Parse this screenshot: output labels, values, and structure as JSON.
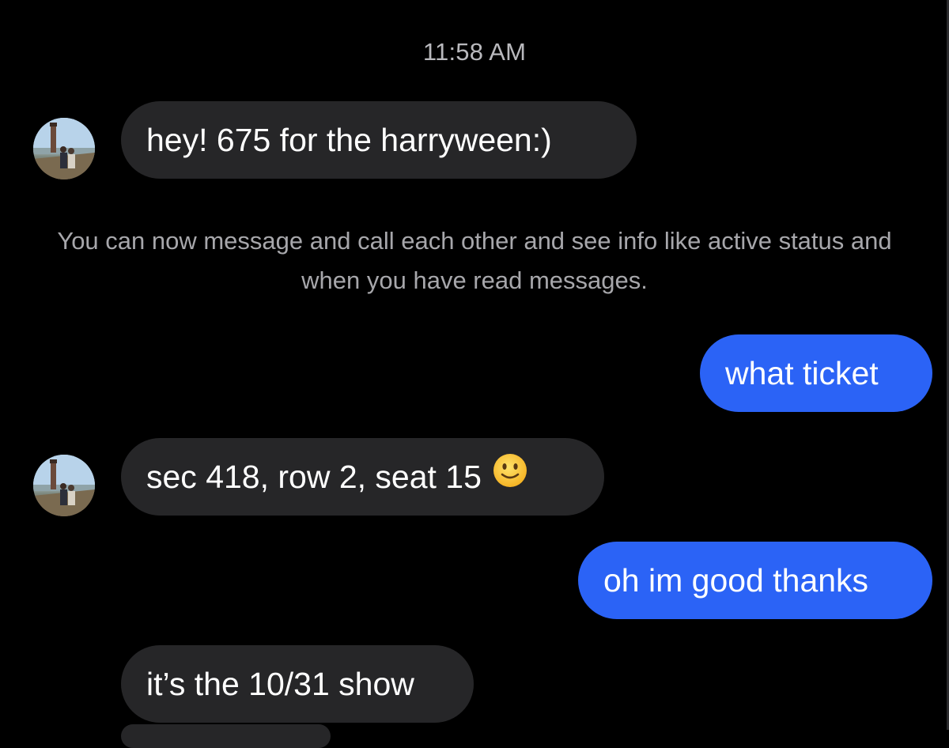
{
  "conversation": {
    "timestamp": "11:58 AM",
    "system_note": "You can now message and call each other and see info like active status and when you have read messages.",
    "messages": [
      {
        "from": "them",
        "text": "hey! 675 for the harryween:)"
      },
      {
        "from": "me",
        "text": "what ticket"
      },
      {
        "from": "them",
        "text": "sec 418, row 2, seat 15",
        "emoji": "slightly-smiling-face"
      },
      {
        "from": "me",
        "text": "oh im good thanks"
      },
      {
        "from": "them",
        "text": "it’s the 10/31 show"
      }
    ]
  },
  "colors": {
    "background": "#000000",
    "incoming_bubble": "#262628",
    "outgoing_bubble": "#2b63f6",
    "timestamp_text": "#b9b9bd",
    "system_text": "#a7a7ab"
  },
  "icons": {
    "avatar": "profile-photo",
    "emoji": "slightly-smiling-face-icon"
  }
}
